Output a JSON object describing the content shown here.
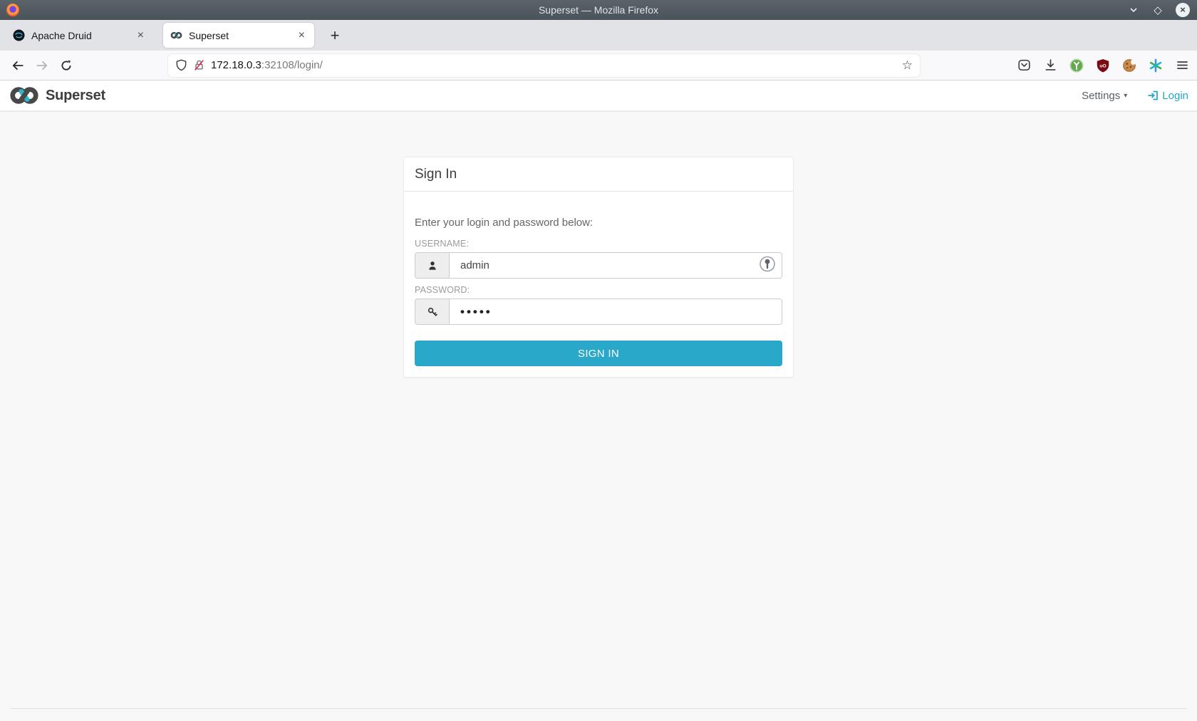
{
  "window": {
    "title": "Superset — Mozilla Firefox"
  },
  "tab_bar": {
    "tabs": [
      {
        "label": "Apache Druid",
        "active": false
      },
      {
        "label": "Superset",
        "active": true
      }
    ]
  },
  "toolbar": {
    "url_host": "172.18.0.3",
    "url_path": ":32108/login/"
  },
  "header": {
    "brand": "Superset",
    "settings_label": "Settings",
    "login_label": "Login"
  },
  "login": {
    "title": "Sign In",
    "instruction": "Enter your login and password below:",
    "username_label": "USERNAME:",
    "username_value": "admin",
    "password_label": "PASSWORD:",
    "password_value": "•••••",
    "submit_label": "SIGN IN"
  },
  "icons": {
    "close": "×",
    "new_tab": "+",
    "caret_down": "▾",
    "bookmark_star": "☆",
    "maximize_diamond": "◇"
  },
  "colors": {
    "accent_teal": "#20A7C9",
    "button_teal": "#2AA8CA",
    "titlebar": "#4e565e",
    "ublock_red": "#7a0b12"
  }
}
